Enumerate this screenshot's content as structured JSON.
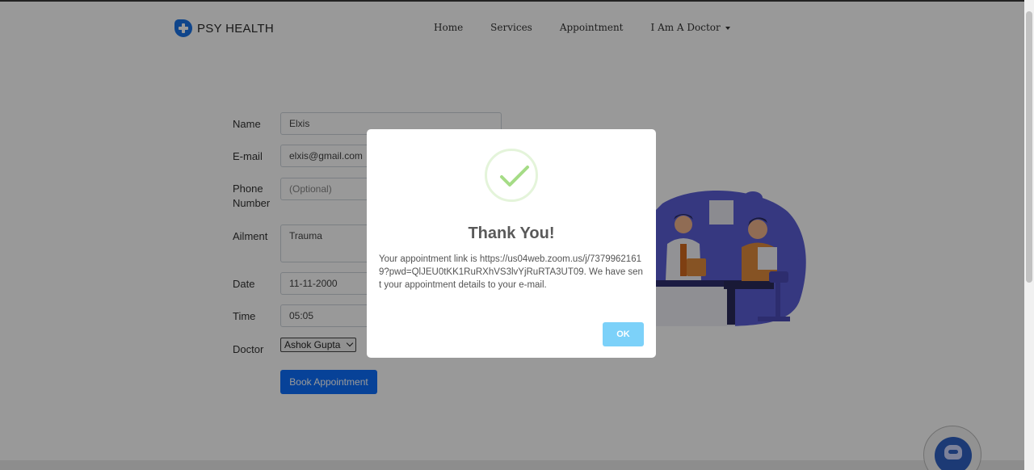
{
  "brand": {
    "name": "PSY HEALTH"
  },
  "nav": {
    "home": "Home",
    "services": "Services",
    "appointment": "Appointment",
    "doctor_menu": "I Am A Doctor"
  },
  "form": {
    "name_label": "Name",
    "name_value": "Elxis",
    "email_label": "E-mail",
    "email_value": "elxis@gmail.com",
    "phone_label": "Phone Number",
    "phone_placeholder": "(Optional)",
    "ailment_label": "Ailment",
    "ailment_value": "Trauma",
    "date_label": "Date",
    "date_value": "11-11-2000",
    "time_label": "Time",
    "time_value": "05:05",
    "doctor_label": "Doctor",
    "doctor_value": "Ashok Gupta",
    "submit_label": "Book Appointment"
  },
  "modal": {
    "title": "Thank You!",
    "message": "Your appointment link is https://us04web.zoom.us/j/73799621619?pwd=QlJEU0tKK1RuRXhVS3lvYjRuRTA3UT09. We have sent your appointment details to your e-mail.",
    "ok_label": "OK"
  },
  "colors": {
    "accent": "#0d6efd",
    "ok_button": "#7cd1f9",
    "success": "#a5dc86",
    "illustration": "#5a5ed6"
  },
  "icons": {
    "brand": "medical-cross-icon",
    "success": "checkmark-icon",
    "chatbot": "robot-icon"
  }
}
